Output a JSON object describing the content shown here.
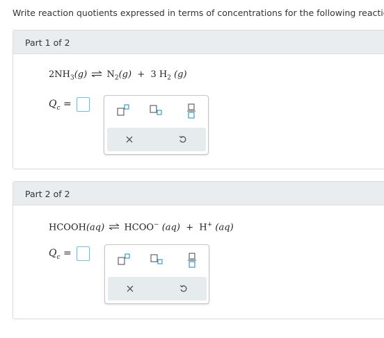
{
  "instructions": "Write reaction quotients expressed in terms of concentrations for the following reactions.",
  "parts": [
    {
      "title": "Part 1 of 2",
      "equation": {
        "reactant": "2NH",
        "reactant_sub": "3",
        "reactant_state": "(g)",
        "product1": "N",
        "product1_sub": "2",
        "product1_state": "(g)",
        "plus": "+",
        "product2": "3 H",
        "product2_sub": "2",
        "product2_state": "(g)"
      },
      "qc_label": "Q",
      "qc_sub": "c",
      "equals": "=",
      "answer_value": ""
    },
    {
      "title": "Part 2 of 2",
      "equation": {
        "reactant": "HCOOH",
        "reactant_state": "(aq)",
        "product1": "HCOO",
        "product1_sup": "−",
        "product1_state": "(aq)",
        "plus": "+",
        "product2": "H",
        "product2_sup": "+",
        "product2_state": "(aq)"
      },
      "qc_label": "Q",
      "qc_sub": "c",
      "equals": "=",
      "answer_value": ""
    }
  ],
  "toolbar": {
    "buttons": [
      "superscript-icon",
      "subscript-icon",
      "fraction-icon",
      "clear-icon",
      "undo-icon"
    ],
    "accent": "#3b9bc4"
  }
}
